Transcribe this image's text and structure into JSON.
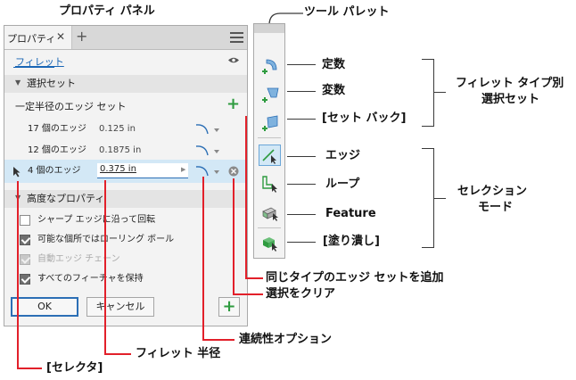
{
  "titles": {
    "property_panel": "プロパティ パネル",
    "tool_palette": "ツール パレット"
  },
  "panel": {
    "tab_label": "プロパティ",
    "close_glyph": "✕",
    "add_tab_glyph": "+",
    "menu_glyph": "☰",
    "feature_name": "フィレット",
    "selection_set": {
      "header": "選択セット",
      "subheader": "一定半径のエッジ セット",
      "rows": [
        {
          "count": "17 個のエッジ",
          "value": "0.125 in"
        },
        {
          "count": "12 個のエッジ",
          "value": "0.1875 in"
        },
        {
          "count": "4 個のエッジ",
          "value": "0.375 in"
        }
      ]
    },
    "advanced": {
      "header": "高度なプロパティ",
      "options": [
        {
          "label": "シャープ エッジに沿って回転",
          "state": "unchecked"
        },
        {
          "label": "可能な個所ではローリング ボール",
          "state": "checked"
        },
        {
          "label": "自動エッジ チェーン",
          "state": "disabled"
        },
        {
          "label": "すべてのフィーチャを保持",
          "state": "checked"
        }
      ]
    },
    "ok_label": "OK",
    "cancel_label": "キャンセル",
    "plus_glyph": "+"
  },
  "palette_callouts": {
    "constant": "定数",
    "variable": "変数",
    "setback": "[セット バック]",
    "edge": "エッジ",
    "loop": "ループ",
    "feature": "Feature",
    "paint": "[塗り潰し]"
  },
  "group_callouts": {
    "fillet_type_line1": "フィレット  タイプ別",
    "fillet_type_line2": "選択セット",
    "selection_mode_line1": "セレクション",
    "selection_mode_line2": "モード"
  },
  "bottom_callouts": {
    "add_edge_set": "同じタイプのエッジ セットを追加",
    "clear_selection": "選択をクリア",
    "continuity_option": "連続性オプション",
    "fillet_radius": "フィレット 半径",
    "selector": "[セレクタ]"
  },
  "colors": {
    "callout_line": "#e2202a",
    "group_line": "#3a3a3a",
    "link_blue": "#1a66b5",
    "plus_green": "#2e9b3f",
    "active_row": "#d3e8f6"
  }
}
